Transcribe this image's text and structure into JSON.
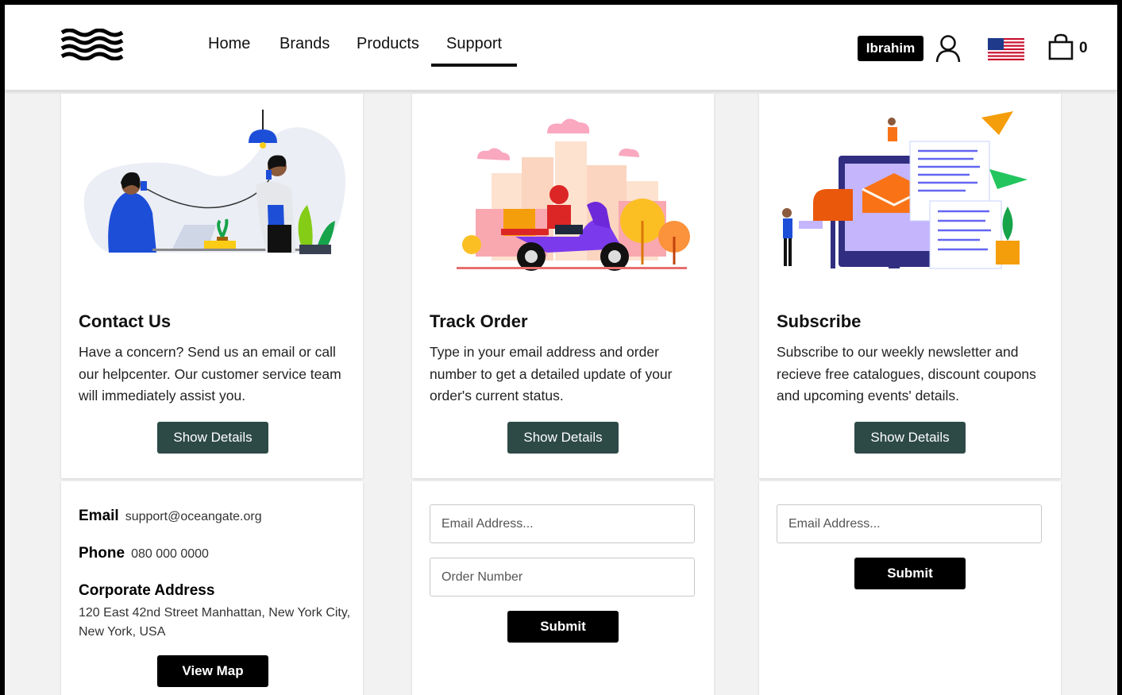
{
  "nav": {
    "links": [
      "Home",
      "Brands",
      "Products",
      "Support"
    ],
    "active": "Support",
    "user_name": "Ibrahim",
    "cart_count": "0",
    "icons": {
      "logo": "waves-logo",
      "user": "user-icon",
      "flag": "us-flag-icon",
      "cart": "shopping-bag-icon"
    }
  },
  "cards": {
    "contact": {
      "title": "Contact Us",
      "desc": "Have a concern? Send us an email or call our helpcenter. Our customer service team will immediately assist you.",
      "button": "Show Details"
    },
    "track": {
      "title": "Track Order",
      "desc": "Type in your email address and order number to get a detailed update of your order's current status.",
      "button": "Show Details"
    },
    "subscribe": {
      "title": "Subscribe",
      "desc": "Subscribe to our weekly newsletter and recieve free catalogues, discount coupons and upcoming events' details.",
      "button": "Show Details"
    }
  },
  "contact_info": {
    "email_label": "Email",
    "email_value": "support@oceangate.org",
    "phone_label": "Phone",
    "phone_value": "080 000 0000",
    "address_label": "Corporate Address",
    "address_value": "120 East 42nd Street Manhattan, New York City, New York, USA",
    "map_button": "View Map"
  },
  "track_form": {
    "email_placeholder": "Email Address...",
    "order_placeholder": "Order Number",
    "submit": "Submit"
  },
  "subscribe_form": {
    "email_placeholder": "Email Address...",
    "submit": "Submit"
  },
  "colors": {
    "accent_button": "#2d4a47",
    "primary_button": "#000000"
  }
}
